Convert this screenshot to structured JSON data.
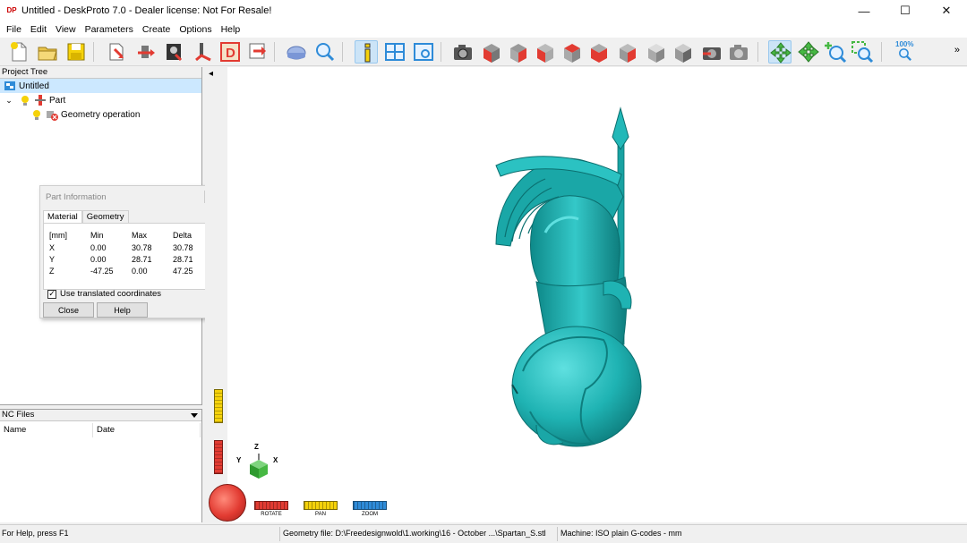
{
  "window": {
    "logo_text": "DP",
    "title": "Untitled - DeskProto 7.0 - Dealer license: Not For Resale!",
    "minimize_glyph": "—",
    "maximize_glyph": "☐",
    "close_glyph": "✕"
  },
  "menu": {
    "items": [
      "File",
      "Edit",
      "View",
      "Parameters",
      "Create",
      "Options",
      "Help"
    ]
  },
  "toolbar": {
    "zoom_level": "100%",
    "more_glyph": "»",
    "buttons": [
      "new-file",
      "open-folder",
      "save",
      "wizard-3axis",
      "wizard-4axis",
      "wizard-bitmap",
      "wizard-vector",
      "wizard-d",
      "export",
      "material-block",
      "zoom-part",
      "part-information",
      "split-views",
      "viewport-single",
      "view-camera",
      "view-front",
      "view-right",
      "view-left",
      "view-back",
      "view-right-red",
      "view-bottom",
      "view-iso",
      "view-grey",
      "view-reset",
      "view-shaded",
      "rotate-mode",
      "pan-mode",
      "zoom-in-mode",
      "zoom-window",
      "zoom-100"
    ],
    "colors": {
      "red": "#e23b32",
      "teal": "#15a9a9",
      "green": "#46b843",
      "blue": "#2e8bd8",
      "yellow": "#f5d20a"
    }
  },
  "project_tree": {
    "header": "Project Tree",
    "items": [
      {
        "label": "Untitled",
        "level": 0
      },
      {
        "label": "Part",
        "level": 1
      },
      {
        "label": "Geometry operation",
        "level": 2
      }
    ]
  },
  "part_info": {
    "title": "Part Information",
    "tabs": [
      "Material",
      "Geometry"
    ],
    "active_tab": "Material",
    "columns": [
      "[mm]",
      "Min",
      "Max",
      "Delta"
    ],
    "rows": [
      [
        "X",
        "0.00",
        "30.78",
        "30.78"
      ],
      [
        "Y",
        "0.00",
        "28.71",
        "28.71"
      ],
      [
        "Z",
        "-47.25",
        "0.00",
        "47.25"
      ]
    ],
    "checkbox_label": "Use translated coordinates",
    "checkbox_checked": true,
    "close_label": "Close",
    "help_label": "Help"
  },
  "nc_files": {
    "header": "NC Files",
    "columns": [
      "Name",
      "Date"
    ]
  },
  "viewport": {
    "model_color": "#1fb3b3",
    "axis_labels": {
      "x": "X",
      "y": "Y",
      "z": "Z"
    },
    "controls": {
      "rotate": "ROTATE",
      "pan": "PAN",
      "zoom": "ZOOM"
    },
    "collapse_glyph": "◂"
  },
  "status": {
    "help": "For Help, press F1",
    "geometry_file": "Geometry file: D:\\Freedesignwold\\1.working\\16 - October ...\\Spartan_S.stl",
    "machine": "Machine: ISO plain G-codes - mm"
  }
}
